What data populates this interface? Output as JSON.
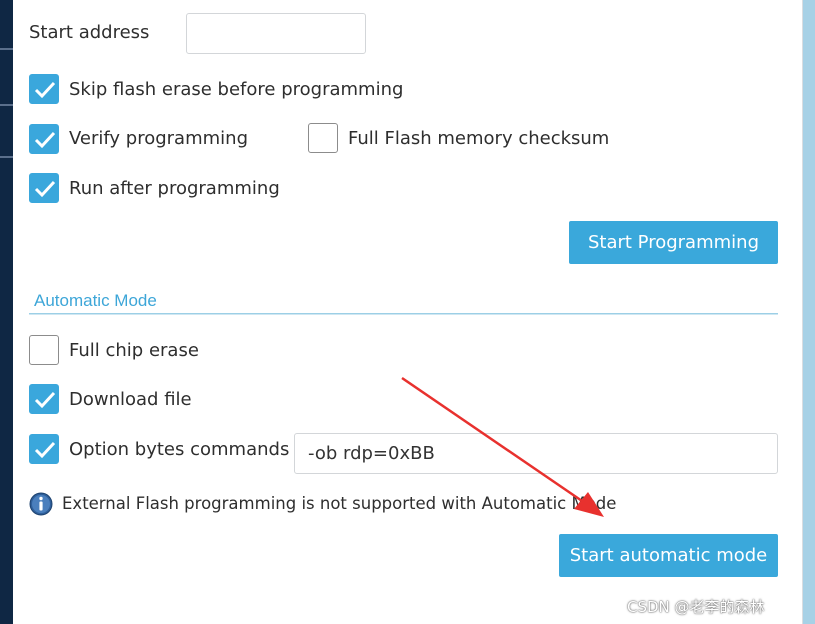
{
  "manual": {
    "start_address_label": "Start address",
    "start_address_value": "",
    "skip_flash_erase": {
      "label": "Skip flash erase before programming",
      "checked": true
    },
    "verify_programming": {
      "label": "Verify programming",
      "checked": true
    },
    "full_flash_checksum": {
      "label": "Full Flash memory checksum",
      "checked": false
    },
    "run_after_programming": {
      "label": "Run after programming",
      "checked": true
    },
    "start_programming_button": "Start Programming"
  },
  "automatic": {
    "section_title": "Automatic Mode",
    "full_chip_erase": {
      "label": "Full chip erase",
      "checked": false
    },
    "download_file": {
      "label": "Download file",
      "checked": true
    },
    "option_bytes_commands": {
      "label": "Option bytes commands",
      "checked": true,
      "value": "-ob rdp=0xBB"
    },
    "info_message": "External Flash programming is not supported with Automatic Mode",
    "start_button": "Start automatic mode"
  },
  "watermark": "CSDN @老李的森林",
  "colors": {
    "accent": "#3aa8db",
    "section": "#3da6d8",
    "arrow": "#e8312e",
    "sidebar": "#0f2744"
  }
}
